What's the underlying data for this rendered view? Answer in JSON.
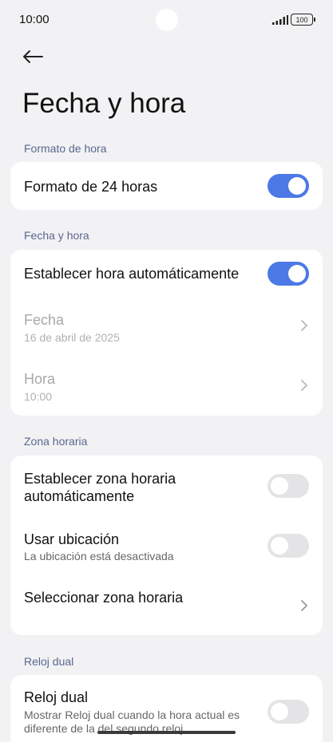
{
  "status_bar": {
    "time": "10:00",
    "battery": "100"
  },
  "icons": {
    "back": "arrow-left-icon",
    "chevron": "chevron-right-icon",
    "signal": "signal-icon",
    "battery": "battery-icon"
  },
  "colors": {
    "accent": "#4c79e6",
    "background": "#f2f2f4",
    "section_header": "#5a6690"
  },
  "page": {
    "title": "Fecha y hora"
  },
  "sections": {
    "time_format": {
      "header": "Formato de hora",
      "format_24h": {
        "label": "Formato de 24 horas",
        "enabled": true
      }
    },
    "date_time": {
      "header": "Fecha y hora",
      "auto_time": {
        "label": "Establecer hora automáticamente",
        "enabled": true
      },
      "date": {
        "label": "Fecha",
        "value": "16 de abril de 2025"
      },
      "time": {
        "label": "Hora",
        "value": "10:00"
      }
    },
    "time_zone": {
      "header": "Zona horaria",
      "auto_zone": {
        "label_line1": "Establecer zona horaria",
        "label_line2": "automáticamente",
        "enabled": false
      },
      "use_location": {
        "label": "Usar ubicación",
        "sub": "La ubicación está desactivada",
        "enabled": false
      },
      "select_zone": {
        "label": "Seleccionar zona horaria"
      }
    },
    "dual_clock": {
      "header": "Reloj dual",
      "dual_clock": {
        "label": "Reloj dual",
        "sub_line1": "Mostrar Reloj dual cuando la hora actual es",
        "sub_line2": "diferente de la del segundo reloj",
        "enabled": false
      }
    }
  }
}
